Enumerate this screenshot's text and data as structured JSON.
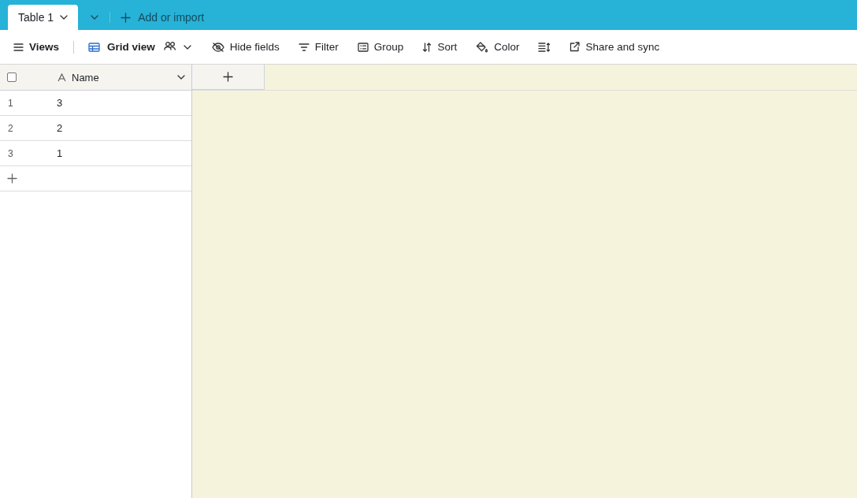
{
  "tabs": [
    {
      "label": "Table 1",
      "selected": true
    }
  ],
  "add_table": {
    "label": "Add or import"
  },
  "toolbar": {
    "views": "Views",
    "view_name": "Grid view",
    "buttons": [
      {
        "kind": "hide",
        "label": "Hide fields"
      },
      {
        "kind": "filter",
        "label": "Filter"
      },
      {
        "kind": "group",
        "label": "Group"
      },
      {
        "kind": "sort",
        "label": "Sort"
      },
      {
        "kind": "color",
        "label": "Color"
      },
      {
        "kind": "row-height"
      },
      {
        "kind": "share",
        "label": "Share and sync"
      }
    ]
  },
  "grid": {
    "select_all": {
      "checked": false
    },
    "columns": [
      {
        "label": "Name"
      }
    ],
    "rows": [
      {
        "number": "1",
        "name": "3"
      },
      {
        "number": "2",
        "name": "2"
      },
      {
        "number": "3",
        "name": "1"
      }
    ]
  }
}
